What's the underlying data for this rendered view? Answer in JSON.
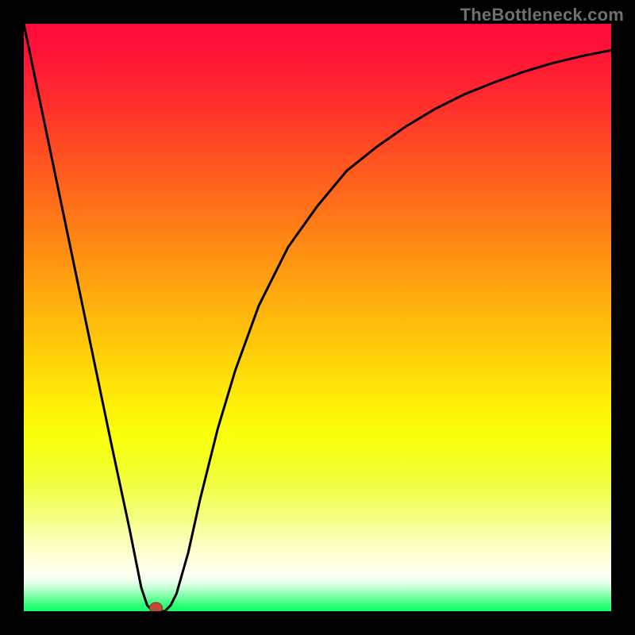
{
  "watermark": "TheBottleneck.com",
  "chart_data": {
    "type": "line",
    "title": "",
    "xlabel": "",
    "ylabel": "",
    "xlim": [
      0,
      100
    ],
    "ylim": [
      0,
      100
    ],
    "x": [
      0,
      5,
      10,
      15,
      18,
      20,
      21,
      22,
      23,
      24,
      25,
      26,
      28,
      30,
      33,
      36,
      40,
      45,
      50,
      55,
      60,
      65,
      70,
      75,
      80,
      85,
      90,
      95,
      100
    ],
    "values": [
      100,
      76,
      52,
      28,
      14,
      4,
      1,
      0,
      0,
      0,
      1,
      3,
      10,
      19,
      31,
      41,
      52,
      62,
      69,
      75,
      79,
      82.5,
      85.5,
      88,
      90,
      91.8,
      93.3,
      94.5,
      95.5
    ],
    "marker": {
      "x": 22.5,
      "y": 0
    },
    "gradient_stops": [
      {
        "offset": 0.0,
        "color": "#ff0b3b"
      },
      {
        "offset": 0.05,
        "color": "#ff1436"
      },
      {
        "offset": 0.1,
        "color": "#ff2230"
      },
      {
        "offset": 0.15,
        "color": "#ff342a"
      },
      {
        "offset": 0.2,
        "color": "#ff4724"
      },
      {
        "offset": 0.25,
        "color": "#ff5a1f"
      },
      {
        "offset": 0.3,
        "color": "#ff6d1a"
      },
      {
        "offset": 0.35,
        "color": "#ff8016"
      },
      {
        "offset": 0.4,
        "color": "#ff9312"
      },
      {
        "offset": 0.45,
        "color": "#ffa60f"
      },
      {
        "offset": 0.5,
        "color": "#ffb90c"
      },
      {
        "offset": 0.55,
        "color": "#ffcb0a"
      },
      {
        "offset": 0.6,
        "color": "#ffde08"
      },
      {
        "offset": 0.65,
        "color": "#fff007"
      },
      {
        "offset": 0.7,
        "color": "#faff0b"
      },
      {
        "offset": 0.73,
        "color": "#f5ff18"
      },
      {
        "offset": 0.76,
        "color": "#f2ff2d"
      },
      {
        "offset": 0.79,
        "color": "#f1ff49"
      },
      {
        "offset": 0.82,
        "color": "#f2ff6a"
      },
      {
        "offset": 0.85,
        "color": "#f6ff8f"
      },
      {
        "offset": 0.88,
        "color": "#fcffb7"
      },
      {
        "offset": 0.91,
        "color": "#ffffd9"
      },
      {
        "offset": 0.925,
        "color": "#ffffe8"
      },
      {
        "offset": 0.935,
        "color": "#fffff1"
      },
      {
        "offset": 0.945,
        "color": "#f4fff2"
      },
      {
        "offset": 0.955,
        "color": "#d6ffe0"
      },
      {
        "offset": 0.965,
        "color": "#acffc4"
      },
      {
        "offset": 0.975,
        "color": "#7affa4"
      },
      {
        "offset": 0.985,
        "color": "#46ff85"
      },
      {
        "offset": 0.995,
        "color": "#1cff6d"
      },
      {
        "offset": 1.0,
        "color": "#0eff64"
      }
    ]
  }
}
